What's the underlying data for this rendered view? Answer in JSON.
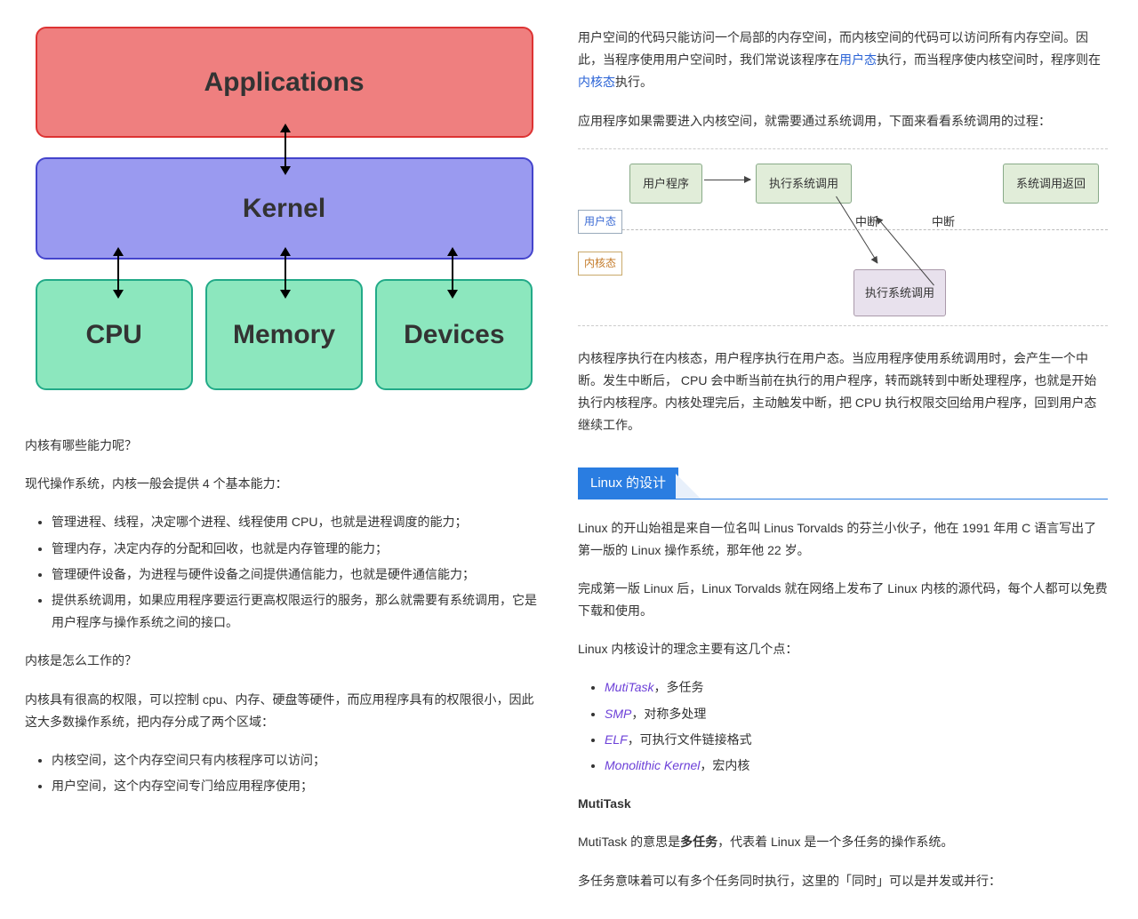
{
  "diagram1": {
    "apps": "Applications",
    "kernel": "Kernel",
    "cpu": "CPU",
    "memory": "Memory",
    "devices": "Devices"
  },
  "left": {
    "q1": "内核有哪些能力呢？",
    "p1": "现代操作系统，内核一般会提供 4 个基本能力：",
    "abilities": [
      "管理进程、线程，决定哪个进程、线程使用 CPU，也就是进程调度的能力；",
      "管理内存，决定内存的分配和回收，也就是内存管理的能力；",
      "管理硬件设备，为进程与硬件设备之间提供通信能力，也就是硬件通信能力；",
      "提供系统调用，如果应用程序要运行更高权限运行的服务，那么就需要有系统调用，它是用户程序与操作系统之间的接口。"
    ],
    "q2": "内核是怎么工作的？",
    "p2": "内核具有很高的权限，可以控制 cpu、内存、硬盘等硬件，而应用程序具有的权限很小，因此这大多数操作系统，把内存分成了两个区域：",
    "regions": [
      "内核空间，这个内存空间只有内核程序可以访问；",
      "用户空间，这个内存空间专门给应用程序使用；"
    ]
  },
  "right": {
    "p1a": "用户空间的代码只能访问一个局部的内存空间，而内核空间的代码可以访问所有内存空间。因此，当程序使用用户空间时，我们常说该程序在",
    "link_user": "用户态",
    "p1b": "执行，而当程序使内核空间时，程序则在",
    "link_kernel": "内核态",
    "p1c": "执行。",
    "p2": "应用程序如果需要进入内核空间，就需要通过系统调用，下面来看看系统调用的过程：",
    "diagram2": {
      "nodes": {
        "userprog": "用户程序",
        "exec_syscall": "执行系统调用",
        "syscall_return": "系统调用返回",
        "exec_syscall_k": "执行系统调用"
      },
      "labels": {
        "user": "用户态",
        "kernel": "内核态"
      },
      "edge_labels": {
        "e1": "中断",
        "e2": "中断"
      }
    },
    "p3": "内核程序执行在内核态，用户程序执行在用户态。当应用程序使用系统调用时，会产生一个中断。发生中断后， CPU 会中断当前在执行的用户程序，转而跳转到中断处理程序，也就是开始执行内核程序。内核处理完后，主动触发中断，把 CPU 执行权限交回给用户程序，回到用户态继续工作。",
    "section_title": "Linux 的设计",
    "p4": "Linux 的开山始祖是来自一位名叫 Linus Torvalds 的芬兰小伙子，他在 1991 年用 C 语言写出了第一版的 Linux 操作系统，那年他 22 岁。",
    "p5": "完成第一版 Linux 后，Linux Torvalds 就在网络上发布了 Linux 内核的源代码，每个人都可以免费下载和使用。",
    "p6": "Linux 内核设计的理念主要有这几个点：",
    "concepts": [
      {
        "em": "MutiTask",
        "rest": "，多任务"
      },
      {
        "em": "SMP",
        "rest": "，对称多处理"
      },
      {
        "em": "ELF",
        "rest": "，可执行文件链接格式"
      },
      {
        "em": "Monolithic Kernel",
        "rest": "，宏内核"
      }
    ],
    "h_mutitask": "MutiTask",
    "p7a": "MutiTask 的意思是",
    "p7b": "多任务",
    "p7c": "，代表着 Linux 是一个多任务的操作系统。",
    "p8": "多任务意味着可以有多个任务同时执行，这里的「同时」可以是并发或并行："
  }
}
